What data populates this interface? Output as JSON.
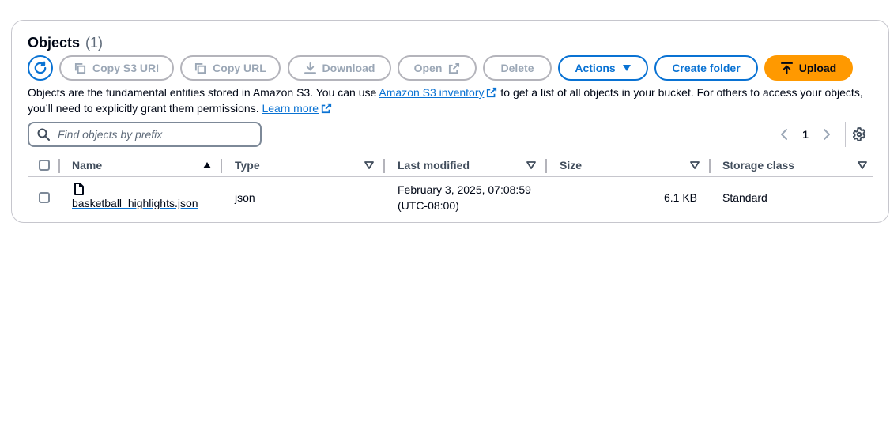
{
  "header": {
    "title": "Objects",
    "count": "(1)"
  },
  "toolbar": {
    "copy_s3_uri": "Copy S3 URI",
    "copy_url": "Copy URL",
    "download": "Download",
    "open": "Open",
    "delete": "Delete",
    "actions": "Actions",
    "create_folder": "Create folder",
    "upload": "Upload"
  },
  "description": {
    "part1": "Objects are the fundamental entities stored in Amazon S3. You can use ",
    "link1": "Amazon S3 inventory",
    "part2": " to get a list of all objects in your bucket. For others to access your objects, you’ll need to explicitly grant them permissions. ",
    "link2": "Learn more"
  },
  "search": {
    "placeholder": "Find objects by prefix",
    "value": ""
  },
  "pagination": {
    "current_page": "1"
  },
  "table": {
    "columns": [
      "Name",
      "Type",
      "Last modified",
      "Size",
      "Storage class"
    ],
    "rows": [
      {
        "name": "basketball_highlights.json",
        "type": "json",
        "last_modified_line1": "February 3, 2025, 07:08:59",
        "last_modified_line2": "(UTC-08:00)",
        "size": "6.1 KB",
        "storage_class": "Standard"
      }
    ]
  },
  "colors": {
    "accent": "#0972d3",
    "upload": "#ff9900",
    "disabled": "#9ba7b6",
    "border": "#c6c6cd"
  },
  "icons": {
    "refresh": "refresh-icon",
    "copy": "copy-icon",
    "download": "download-icon",
    "external": "external-link-icon",
    "caret": "caret-down-icon",
    "upload": "upload-icon",
    "search": "search-icon",
    "settings": "gear-icon",
    "file": "file-icon"
  }
}
